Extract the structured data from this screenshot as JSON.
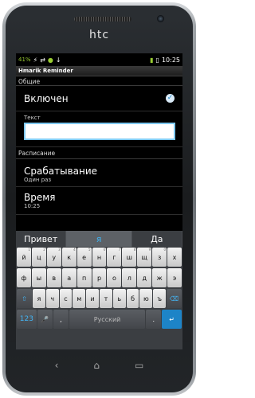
{
  "device": {
    "brand": "htc"
  },
  "status": {
    "battery_pct": "41%",
    "time": "10:25"
  },
  "app": {
    "title": "Hmarik Reminder"
  },
  "sections": {
    "general": "Общие",
    "schedule": "Расписание"
  },
  "prefs": {
    "enabled": {
      "title": "Включен",
      "checked": true
    },
    "text": {
      "label": "Текст",
      "value": ""
    },
    "trigger": {
      "title": "Срабатывание",
      "summary": "Один раз"
    },
    "time": {
      "title": "Время",
      "summary": "10:25"
    }
  },
  "predictions": [
    "Привет",
    "я",
    "Да"
  ],
  "keyboard": {
    "row1": [
      {
        "k": "й",
        "a": "1"
      },
      {
        "k": "ц",
        "a": "2"
      },
      {
        "k": "у",
        "a": "3"
      },
      {
        "k": "к",
        "a": "4"
      },
      {
        "k": "е",
        "a": "5"
      },
      {
        "k": "н",
        "a": "6"
      },
      {
        "k": "г",
        "a": "7"
      },
      {
        "k": "ш",
        "a": "8"
      },
      {
        "k": "щ",
        "a": "9"
      },
      {
        "k": "з",
        "a": "0"
      },
      {
        "k": "х",
        "a": ""
      }
    ],
    "row2": [
      "ф",
      "ы",
      "в",
      "а",
      "п",
      "р",
      "о",
      "л",
      "д",
      "ж",
      "э"
    ],
    "row3": [
      "я",
      "ч",
      "с",
      "м",
      "и",
      "т",
      "ь",
      "б",
      "ю",
      "ъ"
    ],
    "shift": "⇧",
    "backspace": "⌫",
    "numbers": "123",
    "mic": "🎤",
    "comma": ",",
    "space": "Русский",
    "period": ".",
    "enter": "↵"
  },
  "nav": {
    "back": "‹",
    "home": "⌂",
    "recent": "▭"
  }
}
